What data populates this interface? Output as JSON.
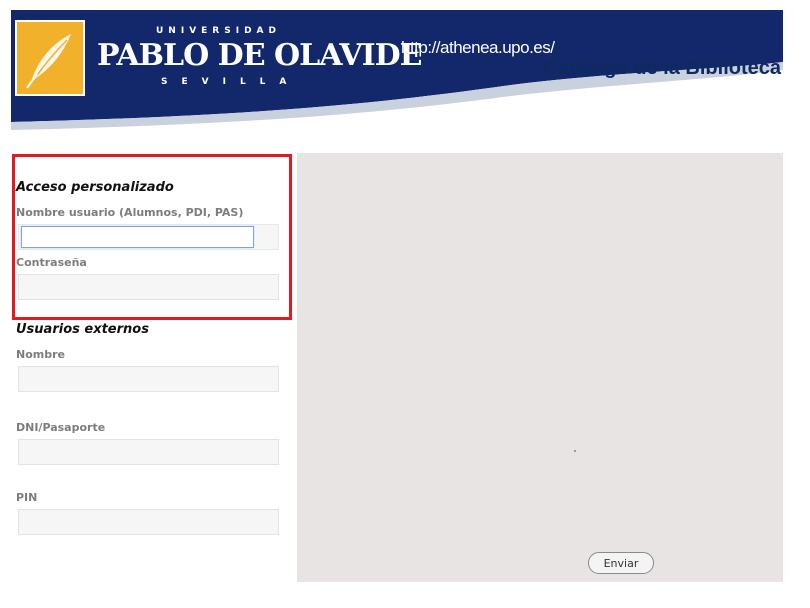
{
  "header": {
    "university_top": "UNIVERSIDAD",
    "university_name": "PABLO DE OLAVIDE",
    "university_city": "SEVILLA",
    "url": "http://athenea.upo.es/",
    "catalog_title": "Catálogo de la Biblioteca"
  },
  "personal_access": {
    "title": "Acceso personalizado",
    "username_label": "Nombre usuario (Alumnos, PDI, PAS)",
    "username_value": "",
    "password_label": "Contraseña",
    "password_value": ""
  },
  "external_users": {
    "title": "Usuarios externos",
    "name_label": "Nombre",
    "name_value": "",
    "dni_label": "DNI/Pasaporte",
    "dni_value": "",
    "pin_label": "PIN",
    "pin_value": ""
  },
  "submit_label": "Enviar",
  "colors": {
    "header_navy": "#12286a",
    "logo_orange": "#f2b12a",
    "highlight_red": "#e01a22",
    "content_bg": "#e8e4e4"
  }
}
